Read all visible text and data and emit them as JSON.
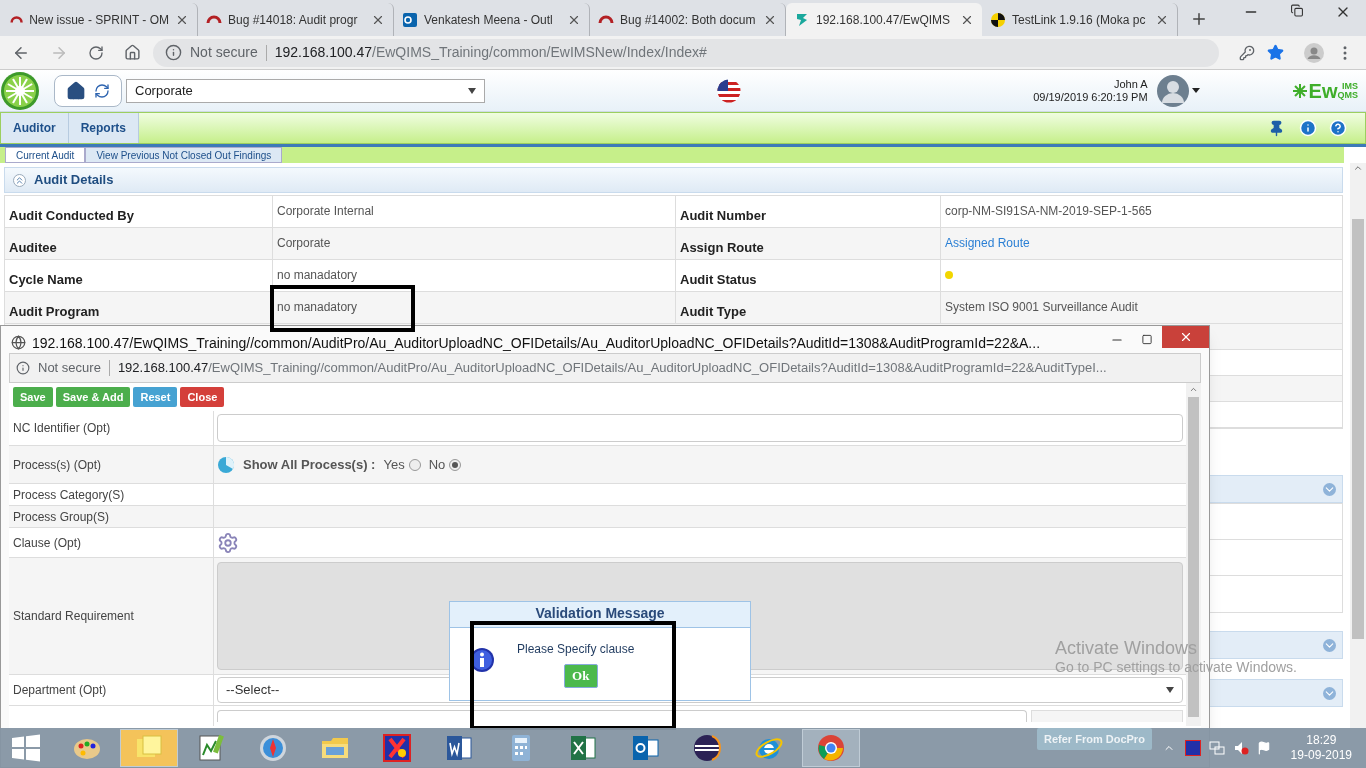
{
  "browser": {
    "tabs": [
      {
        "title": "New issue - SPRINT - OM",
        "kind": "arc",
        "selected": false
      },
      {
        "title": "Bug #14018: Audit progr",
        "kind": "arc",
        "selected": false
      },
      {
        "title": "Venkatesh Meena - Outl",
        "kind": "mail",
        "selected": false
      },
      {
        "title": "Bug #14002: Both docum",
        "kind": "arc",
        "selected": false
      },
      {
        "title": "192.168.100.47/EwQIMS",
        "kind": "app",
        "selected": true
      },
      {
        "title": "TestLink 1.9.16 (Moka pc",
        "kind": "test",
        "selected": false
      }
    ],
    "address": {
      "secure_label": "Not secure",
      "host": "192.168.100.47",
      "path": "/EwQIMS_Training/common/EwIMSNew/Index/Index#"
    }
  },
  "header": {
    "location": "Corporate",
    "user": "John A",
    "datetime": "09/19/2019 6:20:19 PM",
    "logo": {
      "main": "Ew",
      "top": "IMS",
      "bottom": "QMS"
    }
  },
  "menu": [
    "Auditor",
    "Reports"
  ],
  "subtabs": [
    {
      "label": "Current Audit",
      "selected": true
    },
    {
      "label": "View Previous Not Closed Out Findings",
      "selected": false
    }
  ],
  "audit_details": {
    "title": "Audit Details",
    "rows": [
      {
        "left": {
          "label": "Audit Conducted By",
          "value": "Corporate Internal"
        },
        "right": {
          "label": "Audit Number",
          "kind": "text",
          "value": "corp-NM-SI91SA-NM-2019-SEP-1-565"
        }
      },
      {
        "left": {
          "label": "Auditee",
          "value": "Corporate"
        },
        "right": {
          "label": "Assign Route",
          "kind": "link",
          "value": "Assigned Route"
        }
      },
      {
        "left": {
          "label": "Cycle Name",
          "value": "no manadatory"
        },
        "right": {
          "label": "Audit Status",
          "kind": "status",
          "color": "#f2d600"
        }
      },
      {
        "left": {
          "label": "Audit Program",
          "value": "no manadatory"
        },
        "right": {
          "label": "Audit Type",
          "kind": "text",
          "value": "System ISO 9001 Surveillance Audit"
        }
      }
    ]
  },
  "popup": {
    "title": "192.168.100.47/EwQIMS_Training//common/AuditPro/Au_AuditorUploadNC_OFIDetails/Au_AuditorUploadNC_OFIDetails?AuditId=1308&AuditProgramId=22&A...",
    "address": {
      "secure_label": "Not secure",
      "host": "192.168.100.47",
      "path": "/EwQIMS_Training//common/AuditPro/Au_AuditorUploadNC_OFIDetails/Au_AuditorUploadNC_OFIDetails?AuditId=1308&AuditProgramId=22&AuditTypeI..."
    },
    "buttons": [
      {
        "label": "Save",
        "color": "#4cae4c"
      },
      {
        "label": "Save & Add",
        "color": "#4cae4c"
      },
      {
        "label": "Reset",
        "color": "#46a2d2"
      },
      {
        "label": "Close",
        "color": "#d43f3a"
      }
    ],
    "form": [
      {
        "label": "NC Identifier (Opt)",
        "kind": "input"
      },
      {
        "label": "Process(s) (Opt)",
        "kind": "radio",
        "prompt": "Show All Process(s) :",
        "options": [
          {
            "label": "Yes",
            "selected": false
          },
          {
            "label": "No",
            "selected": true
          }
        ]
      },
      {
        "label": "Process Category(S)",
        "kind": "empty"
      },
      {
        "label": "Process Group(S)",
        "kind": "empty"
      },
      {
        "label": "Clause (Opt)",
        "kind": "gear"
      },
      {
        "label": "Standard Requirement",
        "kind": "textarea"
      },
      {
        "label": "Department (Opt)",
        "kind": "select",
        "value": "--Select--"
      }
    ],
    "refer_button": "Refer From DocPro"
  },
  "dialog": {
    "title": "Validation Message",
    "message": "Please Specify clause",
    "button": "Ok"
  },
  "os_notice": {
    "title": "Activate Windows",
    "text": "Go to PC settings to activate Windows."
  },
  "taskbar": {
    "time": "18:29",
    "date": "19-09-2019",
    "apps": [
      {
        "kind": "paint",
        "selected": false,
        "running": false
      },
      {
        "kind": "notes",
        "selected": true,
        "running": true
      },
      {
        "kind": "chart",
        "selected": false,
        "running": false
      },
      {
        "kind": "compass",
        "selected": false,
        "running": false
      },
      {
        "kind": "folder",
        "selected": false,
        "running": false
      },
      {
        "kind": "snip",
        "selected": false,
        "running": false
      },
      {
        "kind": "word",
        "selected": false,
        "running": false
      },
      {
        "kind": "calc",
        "selected": false,
        "running": false
      },
      {
        "kind": "excel",
        "selected": false,
        "running": false
      },
      {
        "kind": "outlook",
        "selected": false,
        "running": false
      },
      {
        "kind": "eclipse",
        "selected": false,
        "running": false
      },
      {
        "kind": "ie",
        "selected": false,
        "running": false
      },
      {
        "kind": "chrome",
        "selected": false,
        "running": true
      }
    ]
  }
}
